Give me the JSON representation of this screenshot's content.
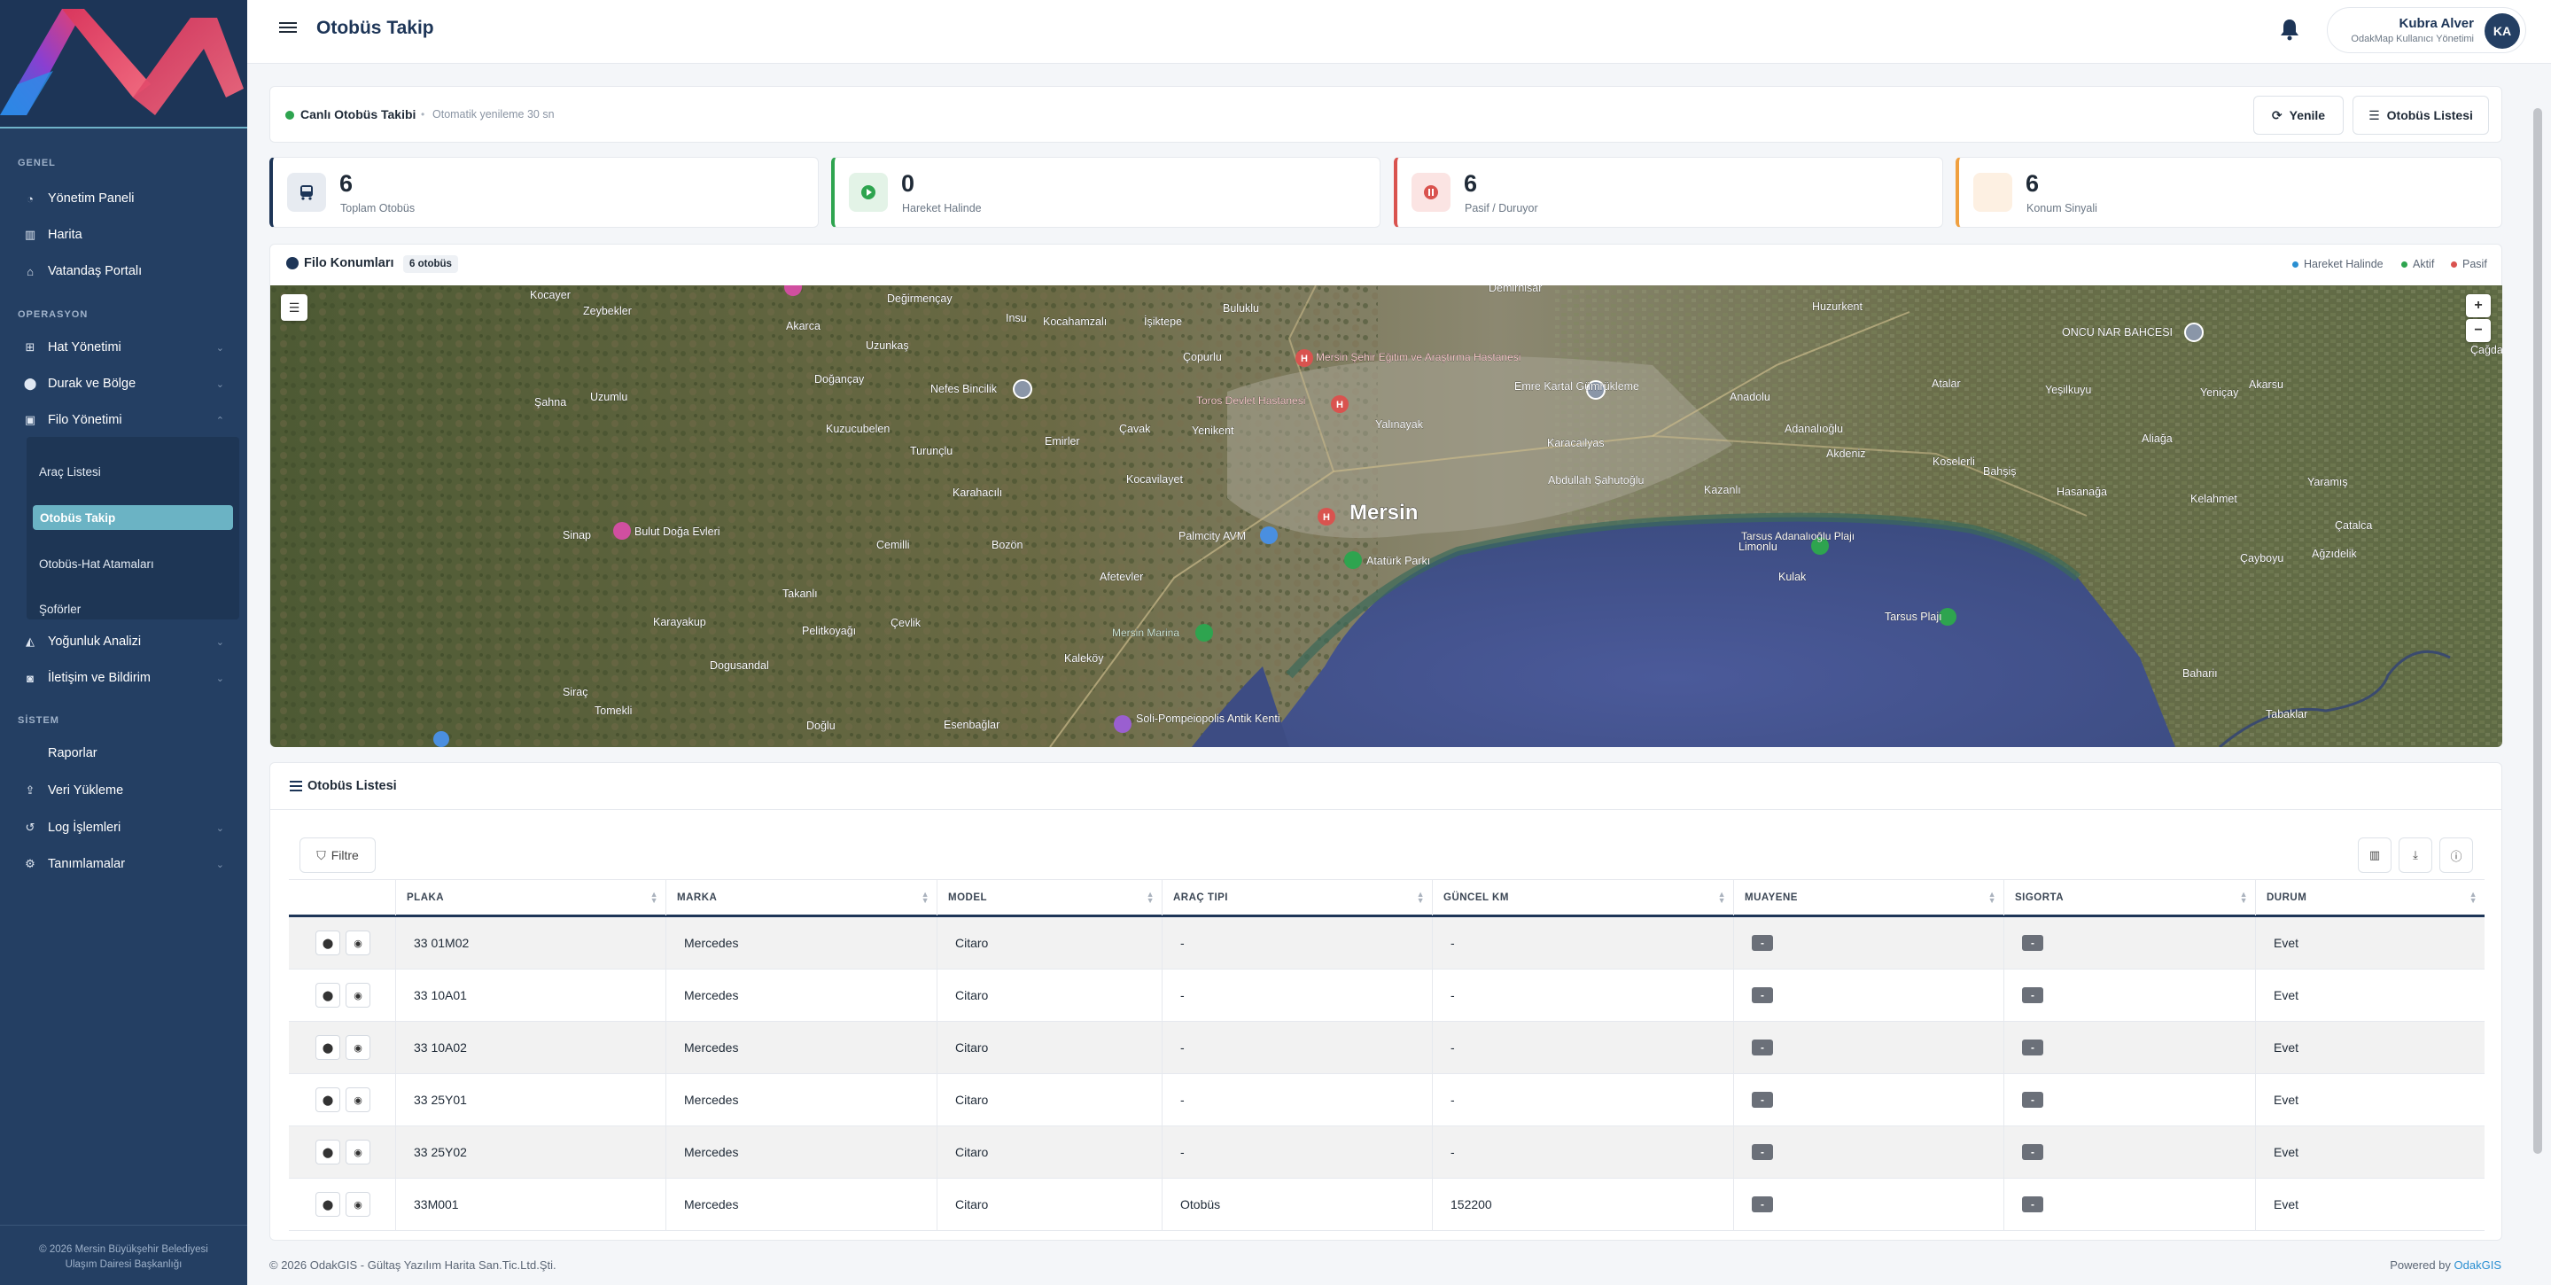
{
  "app": {
    "title": "Otobüs Takip"
  },
  "user": {
    "name": "Kubra Alver",
    "role": "OdakMap Kullanıcı Yönetimi",
    "initials": "KA"
  },
  "sidebar": {
    "sections": {
      "general": "GENEL",
      "operations": "OPERASYON",
      "system": "SİSTEM"
    },
    "items": {
      "dashboard": "Yönetim Paneli",
      "map": "Harita",
      "citizen": "Vatandaş Portalı",
      "lines": "Hat Yönetimi",
      "stops": "Durak ve Bölge",
      "fleet": "Filo Yönetimi",
      "density": "Yoğunluk Analizi",
      "comm": "İletişim ve Bildirim",
      "reports": "Raporlar",
      "upload": "Veri Yükleme",
      "logs": "Log İşlemleri",
      "definitions": "Tanımlamalar"
    },
    "fleet_sub": [
      "Araç Listesi",
      "Otobüs Takip",
      "Otobüs-Hat Atamaları",
      "Şoförler"
    ],
    "footer_line1": "© 2026 Mersin Büyükşehir Belediyesi",
    "footer_line2": "Ulaşım Dairesi Başkanlığı"
  },
  "live": {
    "title": "Canlı Otobüs Takibi",
    "separator": "•",
    "refresh": "Otomatik yenileme 30 sn",
    "refresh_btn": "Yenile",
    "list_btn": "Otobüs Listesi"
  },
  "stats": [
    {
      "value": "6",
      "label": "Toplam Otobüs",
      "color": "#1d3557"
    },
    {
      "value": "0",
      "label": "Hareket Halinde",
      "color": "#2ea44f"
    },
    {
      "value": "6",
      "label": "Pasif / Duruyor",
      "color": "#d9534f"
    },
    {
      "value": "6",
      "label": "Konum Sinyali",
      "color": "#f0a040"
    }
  ],
  "map": {
    "title": "Filo Konumları",
    "badge": "6 otobüs",
    "legend": {
      "moving": "Hareket Halinde",
      "active": "Aktif",
      "passive": "Pasif"
    },
    "legend_colors": {
      "moving": "#2a8fd1",
      "active": "#2ea44f",
      "passive": "#d9534f"
    },
    "zoom_in": "+",
    "zoom_out": "−",
    "city": "Mersin",
    "labels": [
      "Kocayer",
      "Zeybekler",
      "Akarca",
      "Değirmençay",
      "Insu",
      "Kocahamzalı",
      "Buluklu",
      "İşiktepe",
      "Demirhisar",
      "Huzurkent",
      "Uzunkaş",
      "Doğançay",
      "Nefes Bincilik",
      "Çopurlu",
      "Mersin Şehir Eğitim ve Araştırma Hastanesi",
      "Şahna",
      "Uzumlu",
      "Kuzucubelen",
      "Toros Devlet Hastanesi",
      "Yalınayak",
      "Emre Kartal Gümrükleme",
      "Atalar",
      "Yeşilkuyu",
      "Akarsu",
      "ONCU NAR BAHCESI",
      "Çağdaşkent",
      "Turunçlu",
      "Emirler",
      "Çavak",
      "Yenikent",
      "Anadolu",
      "Karacailyas",
      "Adanalıoğlu",
      "Akdeniz",
      "Koselerli",
      "Bahşiş",
      "Aliağa",
      "Yeniçay",
      "Karahacılı",
      "Kocavilayet",
      "Abdullah Şahutoğlu",
      "Kazanlı",
      "Hasanağa",
      "Kelahmet",
      "Yaramış",
      "Sinap",
      "Bulut Doğa Evleri",
      "Cemilli",
      "Bozön",
      "Palmcity AVM",
      "Atatürk Parkı",
      "Limonlu",
      "Tarsus Adanalıoğlu Plajı",
      "Çatalca",
      "Kulak",
      "Çayboyu",
      "Ağzıdelik",
      "Karayakup",
      "Takanlı",
      "Afetevler",
      "Tarsus Plajı",
      "Pelitkoyağı",
      "Çevlik",
      "Mersin Marina",
      "Dogusandal",
      "Kaleköy",
      "Bahariı",
      "Siraç",
      "Tomekli",
      "Doğlu",
      "Esenbağlar",
      "Soli-Pompeiopolis Antik Kenti",
      "Tabaklar"
    ]
  },
  "list": {
    "title": "Otobüs Listesi",
    "filter": "Filtre",
    "columns": [
      "PLAKA",
      "MARKA",
      "MODEL",
      "ARAÇ TIPI",
      "GÜNCEL KM",
      "MUAYENE",
      "SIGORTA",
      "DURUM"
    ],
    "rows": [
      {
        "plate": "33 01M02",
        "brand": "Mercedes",
        "model": "Citaro",
        "type": "-",
        "km": "-",
        "inspection": "-",
        "insurance": "-",
        "status": "Evet"
      },
      {
        "plate": "33 10A01",
        "brand": "Mercedes",
        "model": "Citaro",
        "type": "-",
        "km": "-",
        "inspection": "-",
        "insurance": "-",
        "status": "Evet"
      },
      {
        "plate": "33 10A02",
        "brand": "Mercedes",
        "model": "Citaro",
        "type": "-",
        "km": "-",
        "inspection": "-",
        "insurance": "-",
        "status": "Evet"
      },
      {
        "plate": "33 25Y01",
        "brand": "Mercedes",
        "model": "Citaro",
        "type": "-",
        "km": "-",
        "inspection": "-",
        "insurance": "-",
        "status": "Evet"
      },
      {
        "plate": "33 25Y02",
        "brand": "Mercedes",
        "model": "Citaro",
        "type": "-",
        "km": "-",
        "inspection": "-",
        "insurance": "-",
        "status": "Evet"
      },
      {
        "plate": "33M001",
        "brand": "Mercedes",
        "model": "Citaro",
        "type": "Otobüs",
        "km": "152200",
        "inspection": "-",
        "insurance": "-",
        "status": "Evet"
      }
    ]
  },
  "footer": {
    "left": "© 2026 OdakGIS - Gültaş Yazılım Harita San.Tic.Ltd.Şti.",
    "powered": "Powered by",
    "brand": "OdakGIS"
  }
}
